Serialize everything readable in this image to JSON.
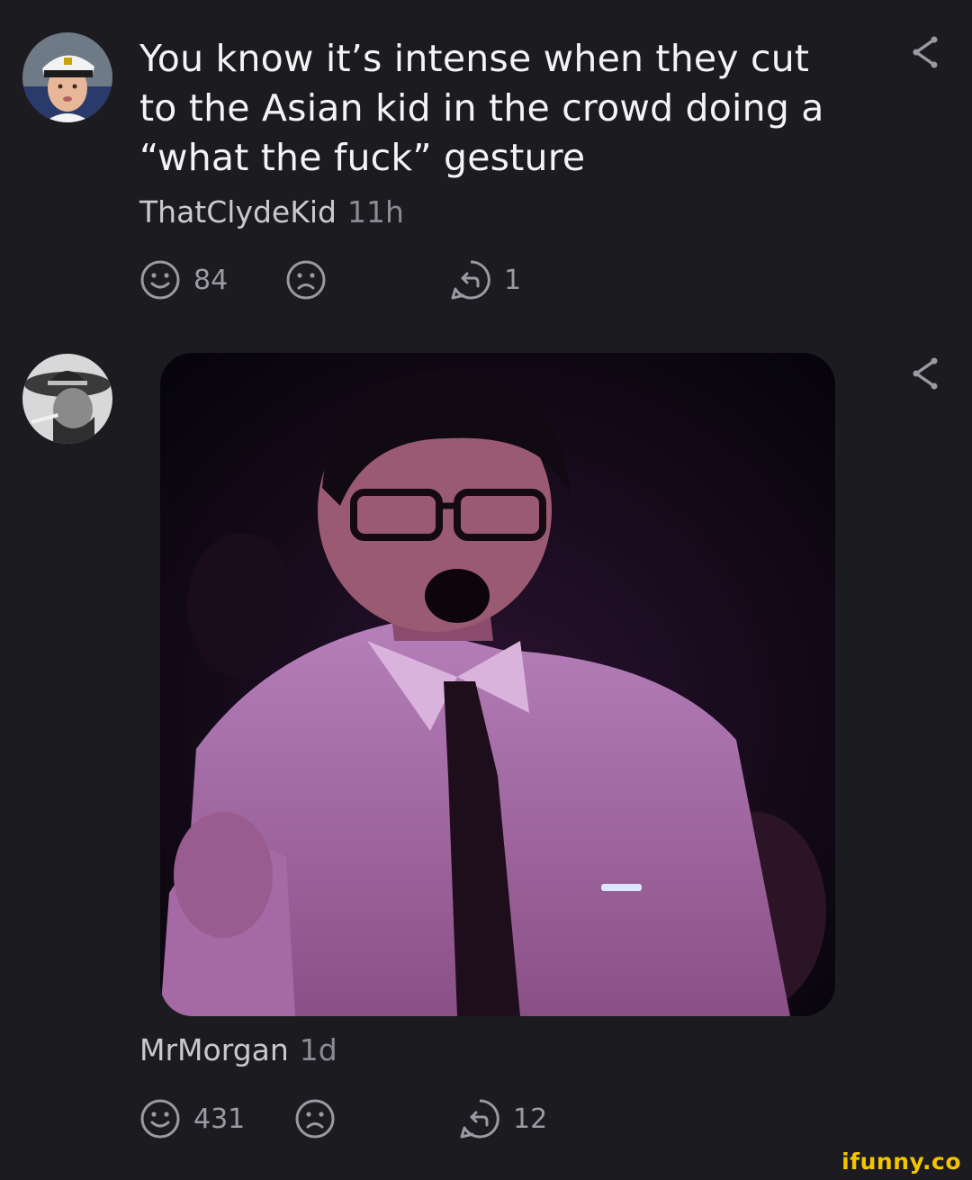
{
  "comments": [
    {
      "avatar": "avatar-captain-hat",
      "text": "You know it’s intense when they cut to the Asian kid in the crowd doing a “what the fuck” gesture",
      "username": "ThatClydeKid",
      "time": "11h",
      "smile_count": "84",
      "frown_count": "",
      "reply_count": "1"
    },
    {
      "avatar": "avatar-cowboy-bw",
      "media": "image-shocked-kid-in-crowd",
      "username": "MrMorgan",
      "time": "1d",
      "smile_count": "431",
      "frown_count": "",
      "reply_count": "12"
    }
  ],
  "icons": {
    "smile": "smile-icon",
    "frown": "frown-icon",
    "reply": "reply-icon",
    "share": "share-icon"
  },
  "watermark": "ifunny.co",
  "colors": {
    "background": "#1b1b20",
    "muted_text": "#9a9aa2",
    "watermark": "#f5c400"
  }
}
